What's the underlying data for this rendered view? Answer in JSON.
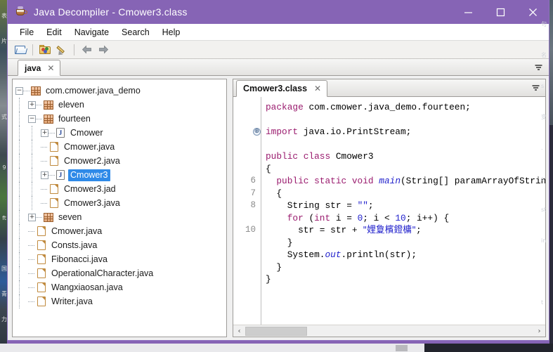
{
  "window": {
    "title": "Java Decompiler - Cmower3.class",
    "app_icon": "coffee-cup-icon",
    "controls": {
      "minimize": "—",
      "maximize": "☐",
      "close": "✕"
    }
  },
  "menubar": {
    "items": [
      "File",
      "Edit",
      "Navigate",
      "Search",
      "Help"
    ]
  },
  "toolbar": {
    "buttons": [
      {
        "name": "open-file",
        "icon": "folder-open-icon"
      },
      {
        "name": "open-package",
        "icon": "package-icon"
      },
      {
        "name": "edit-pencil",
        "icon": "pencil-icon"
      },
      {
        "name": "navigate-back",
        "icon": "arrow-left-icon"
      },
      {
        "name": "navigate-forward",
        "icon": "arrow-right-icon"
      }
    ]
  },
  "main_tabs": {
    "tabs": [
      {
        "label": "java",
        "close": "✕",
        "active": true
      }
    ],
    "overflow_menu": "☰"
  },
  "tree": {
    "nodes": [
      {
        "label": "com.cmower.java_demo",
        "depth": 0,
        "icon": "package-icon",
        "expander": "minus",
        "selected": false
      },
      {
        "label": "eleven",
        "depth": 1,
        "icon": "package-icon",
        "expander": "plus",
        "selected": false
      },
      {
        "label": "fourteen",
        "depth": 1,
        "icon": "package-icon",
        "expander": "minus",
        "selected": false
      },
      {
        "label": "Cmower",
        "depth": 2,
        "icon": "class-icon",
        "expander": "plus",
        "selected": false
      },
      {
        "label": "Cmower.java",
        "depth": 2,
        "icon": "file-icon",
        "expander": "none",
        "selected": false
      },
      {
        "label": "Cmower2.java",
        "depth": 2,
        "icon": "file-icon",
        "expander": "none",
        "selected": false
      },
      {
        "label": "Cmower3",
        "depth": 2,
        "icon": "class-icon",
        "expander": "plus",
        "selected": true
      },
      {
        "label": "Cmower3.jad",
        "depth": 2,
        "icon": "file-icon",
        "expander": "none",
        "selected": false
      },
      {
        "label": "Cmower3.java",
        "depth": 2,
        "icon": "file-icon",
        "expander": "none",
        "selected": false
      },
      {
        "label": "seven",
        "depth": 1,
        "icon": "package-icon",
        "expander": "plus",
        "selected": false
      },
      {
        "label": "Cmower.java",
        "depth": 1,
        "icon": "file-icon",
        "expander": "none",
        "selected": false
      },
      {
        "label": "Consts.java",
        "depth": 1,
        "icon": "file-icon",
        "expander": "none",
        "selected": false
      },
      {
        "label": "Fibonacci.java",
        "depth": 1,
        "icon": "file-icon",
        "expander": "none",
        "selected": false
      },
      {
        "label": "OperationalCharacter.java",
        "depth": 1,
        "icon": "file-icon",
        "expander": "none",
        "selected": false
      },
      {
        "label": "Wangxiaosan.java",
        "depth": 1,
        "icon": "file-icon",
        "expander": "none",
        "selected": false
      },
      {
        "label": "Writer.java",
        "depth": 1,
        "icon": "file-icon",
        "expander": "none",
        "selected": false
      }
    ]
  },
  "editor": {
    "tabs": [
      {
        "label": "Cmower3.class",
        "close": "✕",
        "active": true
      }
    ],
    "overflow_menu": "☰",
    "gutter": [
      "",
      "",
      "",
      "",
      "",
      "",
      "6",
      "7",
      "8",
      "",
      "10",
      "",
      ""
    ],
    "fold_marker_line_index": 2,
    "fold_marker_glyph": "⊕",
    "code_lines": [
      [
        {
          "t": "package",
          "c": "kw"
        },
        {
          "t": " com.cmower.java_demo.fourteen;",
          "c": ""
        }
      ],
      [
        {
          "t": "",
          "c": ""
        }
      ],
      [
        {
          "t": "import",
          "c": "kw"
        },
        {
          "t": " java.io.PrintStream;",
          "c": ""
        }
      ],
      [
        {
          "t": "",
          "c": ""
        }
      ],
      [
        {
          "t": "public class",
          "c": "kw"
        },
        {
          "t": " Cmower3",
          "c": ""
        }
      ],
      [
        {
          "t": "{",
          "c": ""
        }
      ],
      [
        {
          "t": "  ",
          "c": ""
        },
        {
          "t": "public static void",
          "c": "kw"
        },
        {
          "t": " ",
          "c": ""
        },
        {
          "t": "main",
          "c": "fld"
        },
        {
          "t": "(String[] paramArrayOfString)",
          "c": ""
        }
      ],
      [
        {
          "t": "  {",
          "c": ""
        }
      ],
      [
        {
          "t": "    String str = ",
          "c": ""
        },
        {
          "t": "\"\"",
          "c": "str"
        },
        {
          "t": ";",
          "c": ""
        }
      ],
      [
        {
          "t": "    ",
          "c": ""
        },
        {
          "t": "for",
          "c": "kw"
        },
        {
          "t": " (",
          "c": ""
        },
        {
          "t": "int",
          "c": "kw"
        },
        {
          "t": " i = ",
          "c": ""
        },
        {
          "t": "0",
          "c": "num"
        },
        {
          "t": "; i < ",
          "c": ""
        },
        {
          "t": "10",
          "c": "num"
        },
        {
          "t": "; i++) {",
          "c": ""
        }
      ],
      [
        {
          "t": "      str = str + ",
          "c": ""
        },
        {
          "t": "\"娌夐檳鐙槦\"",
          "c": "cjk"
        },
        {
          "t": ";",
          "c": ""
        }
      ],
      [
        {
          "t": "    }",
          "c": ""
        }
      ],
      [
        {
          "t": "    System.",
          "c": ""
        },
        {
          "t": "out",
          "c": "fld"
        },
        {
          "t": ".println(str);",
          "c": ""
        }
      ],
      [
        {
          "t": "  }",
          "c": ""
        }
      ],
      [
        {
          "t": "}",
          "c": ""
        }
      ]
    ],
    "hscroll": {
      "left_arrow": "‹",
      "right_arrow": "›"
    }
  },
  "colors": {
    "titlebar": "#8664b5",
    "selection": "#2f8ae8",
    "keyword": "#9a1b6e",
    "string": "#2222cc",
    "gutter_text": "#8a8a8a"
  },
  "background": {
    "left_strip_glyphs": [
      "表",
      "片",
      "",
      "",
      "式",
      "",
      "9",
      "",
      "ft",
      "",
      "国",
      "青",
      "力"
    ],
    "right_strip_glyphs": [
      "句",
      "名",
      "s",
      "变",
      ".",
      "s",
      "st",
      "in",
      "",
      "t"
    ]
  }
}
